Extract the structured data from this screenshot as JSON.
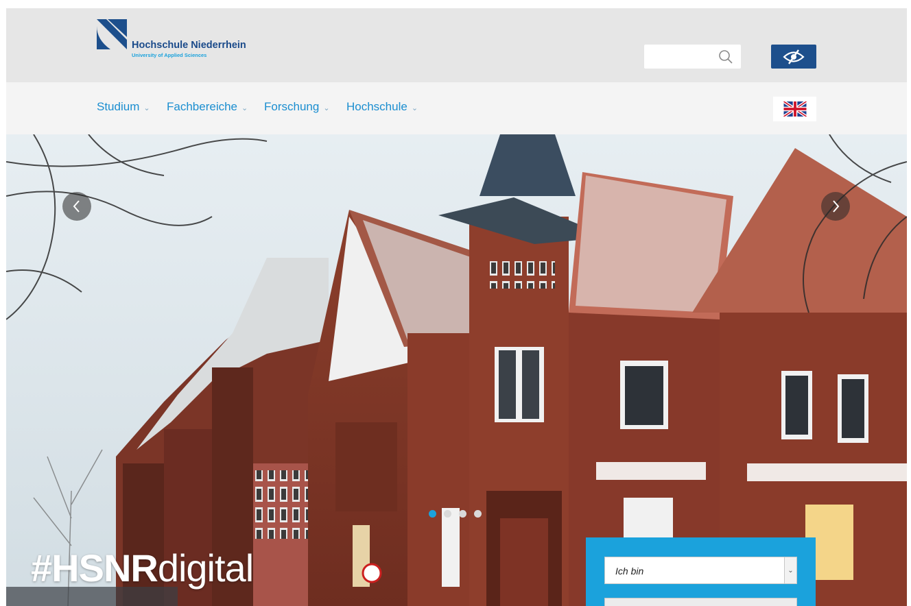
{
  "header": {
    "logo": {
      "name": "Hochschule Niederrhein",
      "subtitle": "University of Applied Sciences"
    },
    "search": {
      "placeholder": "",
      "icon": "search-icon"
    },
    "accessibility_button": {
      "icon": "eye-slash-icon"
    },
    "language_button": {
      "icon": "uk-flag-icon"
    }
  },
  "nav": {
    "items": [
      {
        "label": "Studium"
      },
      {
        "label": "Fachbereiche"
      },
      {
        "label": "Forschung"
      },
      {
        "label": "Hochschule"
      }
    ]
  },
  "hero": {
    "hashtag_bold": "#HSNR",
    "hashtag_light": "digital",
    "slides_total": 4,
    "active_slide": 1,
    "finder": {
      "select_value": "Ich bin"
    }
  },
  "colors": {
    "header_bg": "#e6e6e6",
    "nav_bg": "#f4f4f4",
    "nav_text": "#1b8ed0",
    "brand_dark": "#1d4f8c",
    "accent": "#1ba2dc"
  }
}
